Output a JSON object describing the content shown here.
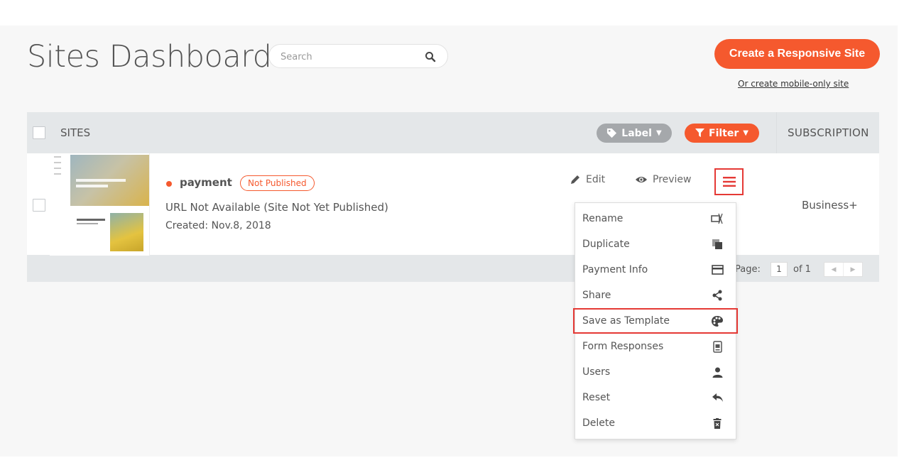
{
  "header": {
    "title": "Sites Dashboard",
    "search_placeholder": "Search",
    "create_button": "Create a Responsive Site",
    "mobile_link": "Or create mobile-only site"
  },
  "table": {
    "col_sites": "SITES",
    "label_button": "Label",
    "filter_button": "Filter",
    "col_subscription": "SUBSCRIPTION",
    "rows": [
      {
        "name": "payment",
        "status": "Not Published",
        "url": "URL Not Available (Site Not Yet Published)",
        "created": "Created: Nov.8, 2018",
        "subscription": "Business+",
        "edit": "Edit",
        "preview": "Preview"
      }
    ],
    "pagination": {
      "label": "Page:",
      "current": "1",
      "of": "of 1"
    }
  },
  "menu": {
    "items": [
      {
        "label": "Rename",
        "icon": "rename-icon"
      },
      {
        "label": "Duplicate",
        "icon": "duplicate-icon"
      },
      {
        "label": "Payment Info",
        "icon": "credit-card-icon"
      },
      {
        "label": "Share",
        "icon": "share-icon"
      },
      {
        "label": "Save as Template",
        "icon": "palette-icon",
        "highlighted": true
      },
      {
        "label": "Form Responses",
        "icon": "form-icon"
      },
      {
        "label": "Users",
        "icon": "user-icon"
      },
      {
        "label": "Reset",
        "icon": "reply-icon"
      },
      {
        "label": "Delete",
        "icon": "trash-icon"
      }
    ]
  },
  "colors": {
    "accent": "#f5592e",
    "highlight_border": "#e53935",
    "header_bg": "#e4e7e9"
  }
}
